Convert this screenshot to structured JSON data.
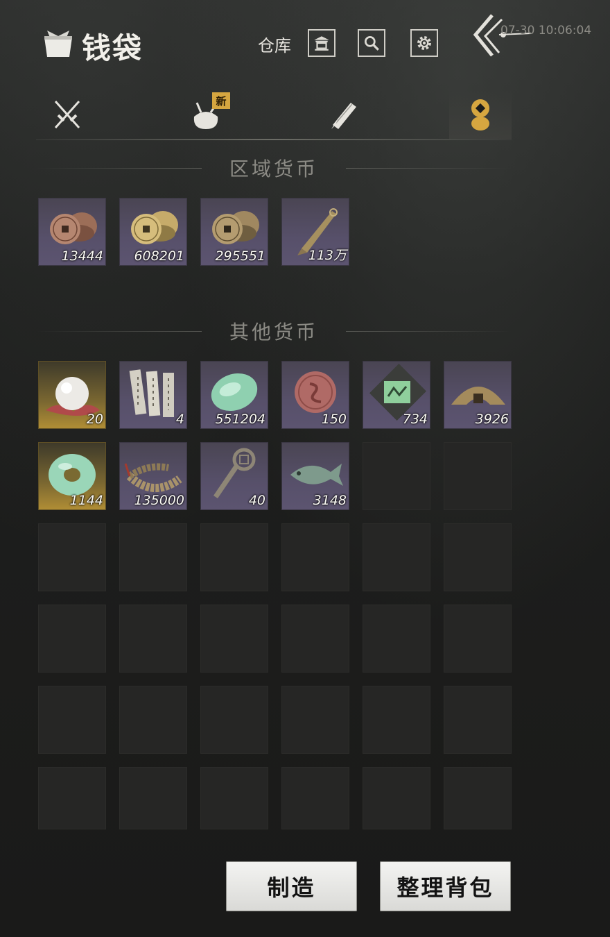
{
  "header": {
    "title": "钱袋",
    "storage_label": "仓库",
    "timestamp": "07-30 10:06:04"
  },
  "tabs": [
    {
      "name": "weapons",
      "badge": ""
    },
    {
      "name": "bundle",
      "badge": "新"
    },
    {
      "name": "scroll",
      "badge": ""
    },
    {
      "name": "currency",
      "badge": "",
      "active": true
    }
  ],
  "sections": {
    "regional": "区域货币",
    "other": "其他货币"
  },
  "regional_items": [
    {
      "icon": "copper-coins",
      "qty": "13444"
    },
    {
      "icon": "brass-coins",
      "qty": "608201"
    },
    {
      "icon": "bronze-coins",
      "qty": "295551"
    },
    {
      "icon": "knife-coin",
      "qty": "113万"
    }
  ],
  "other_items": [
    {
      "icon": "pearl",
      "qty": "20",
      "rarity": "gold"
    },
    {
      "icon": "bamboo-slips",
      "qty": "4"
    },
    {
      "icon": "jade-stone",
      "qty": "551204"
    },
    {
      "icon": "red-seal",
      "qty": "150"
    },
    {
      "icon": "map-token",
      "qty": "734"
    },
    {
      "icon": "half-coin",
      "qty": "3926"
    },
    {
      "icon": "jade-bi-disc",
      "qty": "1144",
      "rarity": "gold"
    },
    {
      "icon": "coin-string",
      "qty": "135000"
    },
    {
      "icon": "key-coin",
      "qty": "40"
    },
    {
      "icon": "jade-fish",
      "qty": "3148"
    }
  ],
  "buttons": {
    "craft": "制造",
    "sort": "整理背包"
  },
  "colors": {
    "accent_gold": "#d6a640",
    "slot_purple": "#57506a",
    "slot_gold": "#b08d35"
  }
}
